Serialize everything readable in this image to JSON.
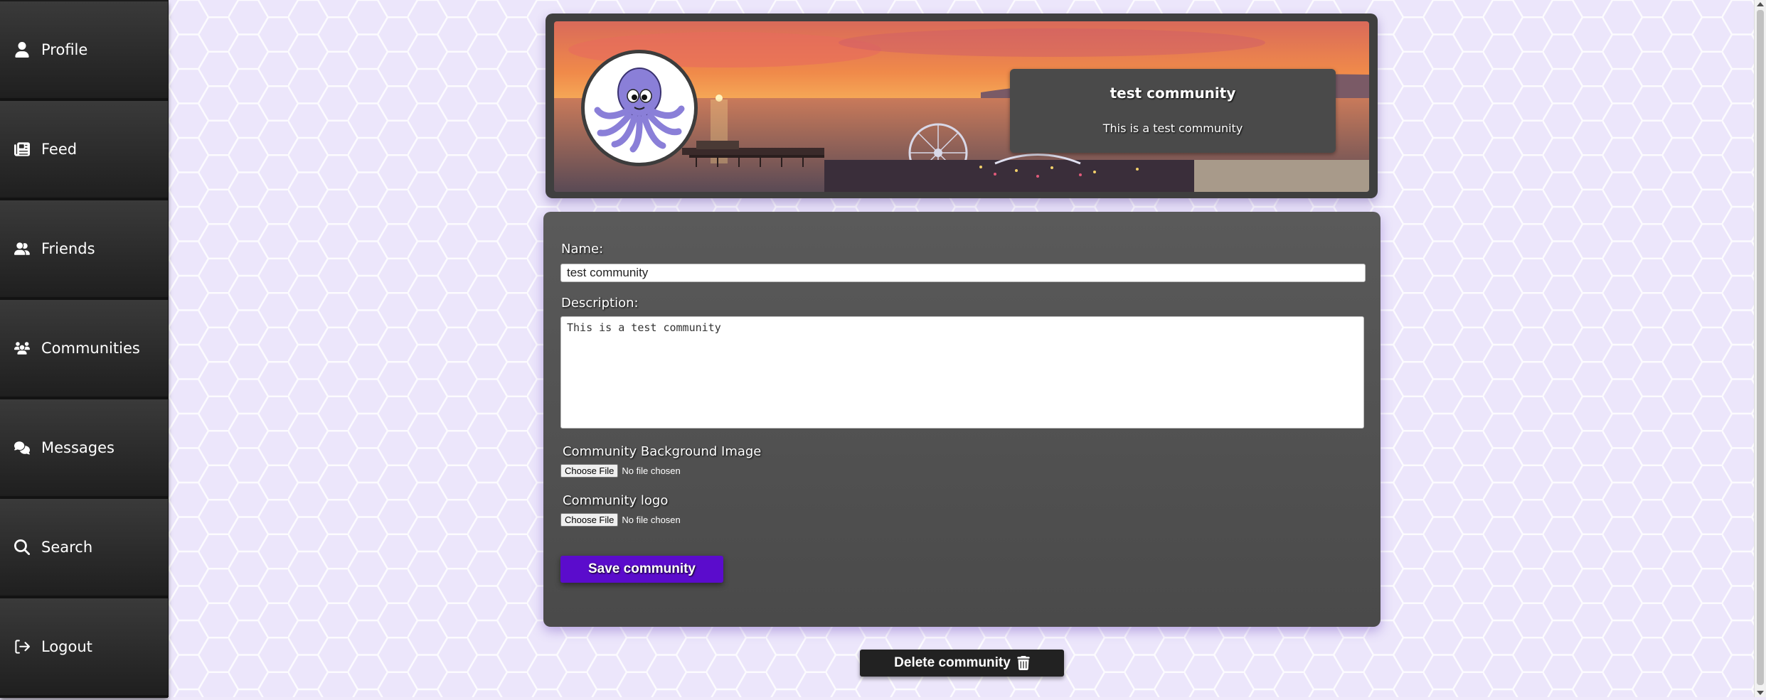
{
  "sidebar": {
    "items": [
      {
        "label": "Profile",
        "icon": "user-icon"
      },
      {
        "label": "Feed",
        "icon": "newspaper-icon"
      },
      {
        "label": "Friends",
        "icon": "user-friends-icon"
      },
      {
        "label": "Communities",
        "icon": "users-icon"
      },
      {
        "label": "Messages",
        "icon": "comments-icon"
      },
      {
        "label": "Search",
        "icon": "search-icon"
      },
      {
        "label": "Logout",
        "icon": "logout-icon"
      }
    ]
  },
  "banner": {
    "title": "test community",
    "description": "This is a test community",
    "logo": "octopus-logo"
  },
  "form": {
    "name_label": "Name:",
    "name_value": "test community",
    "description_label": "Description:",
    "description_value": "This is a test community",
    "bg_image_label": "Community Background Image",
    "logo_label": "Community logo",
    "choose_file_label": "Choose File",
    "no_file_text": "No file chosen",
    "save_label": "Save community"
  },
  "delete_label": "Delete community",
  "colors": {
    "sidebar": "#1e1e1e",
    "accent": "#5b0ccc",
    "card": "#4f4f4f",
    "background": "#efeafc"
  }
}
